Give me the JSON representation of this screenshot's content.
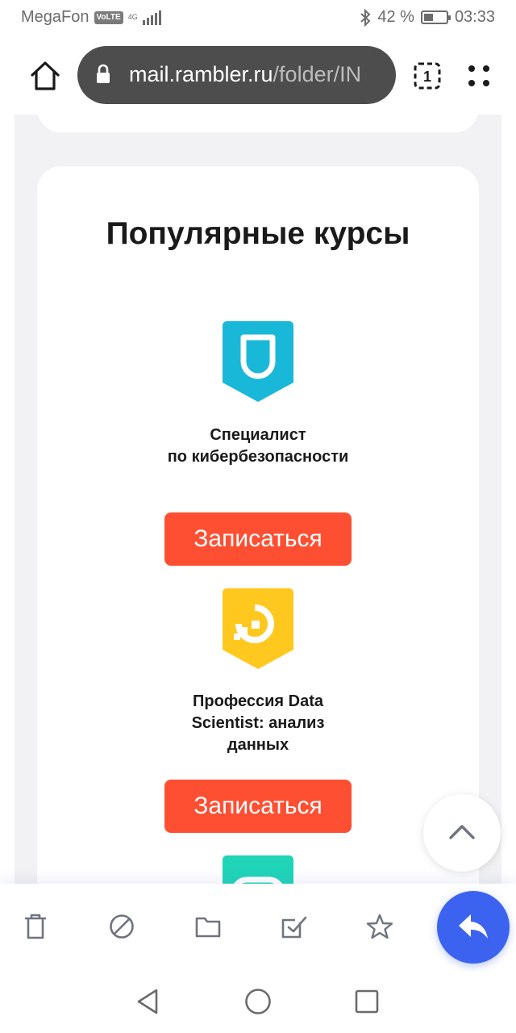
{
  "status_bar": {
    "carrier": "MegaFon",
    "volte": "VoLTE",
    "network": "4G",
    "battery_text": "42 %",
    "battery_level": 0.42,
    "time": "03:33"
  },
  "browser": {
    "url_domain": "mail.rambler.ru",
    "url_path": "/folder/IN",
    "tab_count": "1"
  },
  "section": {
    "title": "Популярные курсы"
  },
  "courses": [
    {
      "name_line1": "Специалист",
      "name_line2": "по кибербезопасности",
      "name_line3": "",
      "button": "Записаться",
      "logo_color": "#1ab8d8",
      "icon": "cybersecurity-logo-icon"
    },
    {
      "name_line1": "Профессия Data",
      "name_line2": "Scientist: анализ",
      "name_line3": "данных",
      "button": "Записаться",
      "logo_color": "#ffc81e",
      "icon": "data-science-logo-icon"
    },
    {
      "logo_color": "#20d4b8",
      "icon": "next-course-logo-icon"
    }
  ],
  "colors": {
    "accent_button": "#ff4f33",
    "fab": "#3c63f0",
    "url_pill": "#4d4d4d"
  },
  "toolbar": {
    "icons": [
      "trash-icon",
      "spam-block-icon",
      "folder-icon",
      "mark-read-icon",
      "star-icon",
      "reply-icon"
    ]
  },
  "navigation": {
    "icons": [
      "back-triangle-icon",
      "home-circle-icon",
      "recents-square-icon"
    ]
  }
}
